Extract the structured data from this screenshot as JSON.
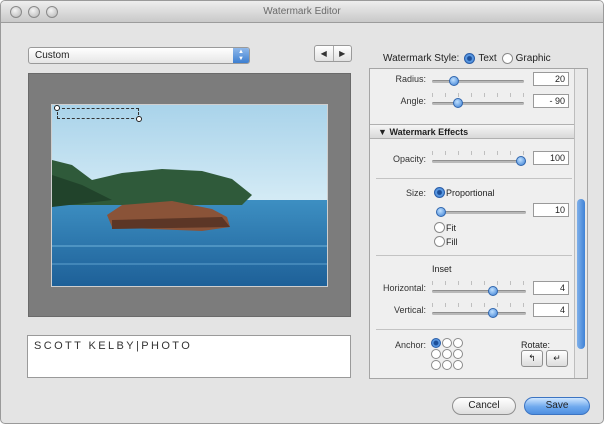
{
  "window": {
    "title": "Watermark Editor"
  },
  "preset": {
    "value": "Custom"
  },
  "nav": {
    "prev": "◀",
    "next": "▶"
  },
  "watermark_style": {
    "label": "Watermark Style:",
    "options": [
      "Text",
      "Graphic"
    ],
    "selected": "Text"
  },
  "watermark_text": "SCOTT KELBY|PHOTO",
  "panel": {
    "radius": {
      "label": "Radius:",
      "value": "20",
      "level": 0.2
    },
    "angle": {
      "label": "Angle:",
      "value": "- 90",
      "level": 0.25
    },
    "effects_header": "Watermark Effects",
    "opacity": {
      "label": "Opacity:",
      "value": "100",
      "level": 1.0
    },
    "size": {
      "label": "Size:",
      "selected": "Proportional",
      "options": [
        "Proportional",
        "Fit",
        "Fill"
      ],
      "value": "10",
      "level": 0.1
    },
    "inset": {
      "label": "Inset"
    },
    "horizontal": {
      "label": "Horizontal:",
      "value": "4",
      "level": 0.6
    },
    "vertical": {
      "label": "Vertical:",
      "value": "4",
      "level": 0.6
    },
    "anchor": {
      "label": "Anchor:",
      "selected_index": 0
    },
    "rotate": {
      "label": "Rotate:"
    }
  },
  "buttons": {
    "cancel": "Cancel",
    "save": "Save"
  },
  "colors": {
    "accent": "#3d7fd1",
    "window_bg": "#e4e4e4",
    "preview_bg": "#7c7c7c"
  }
}
